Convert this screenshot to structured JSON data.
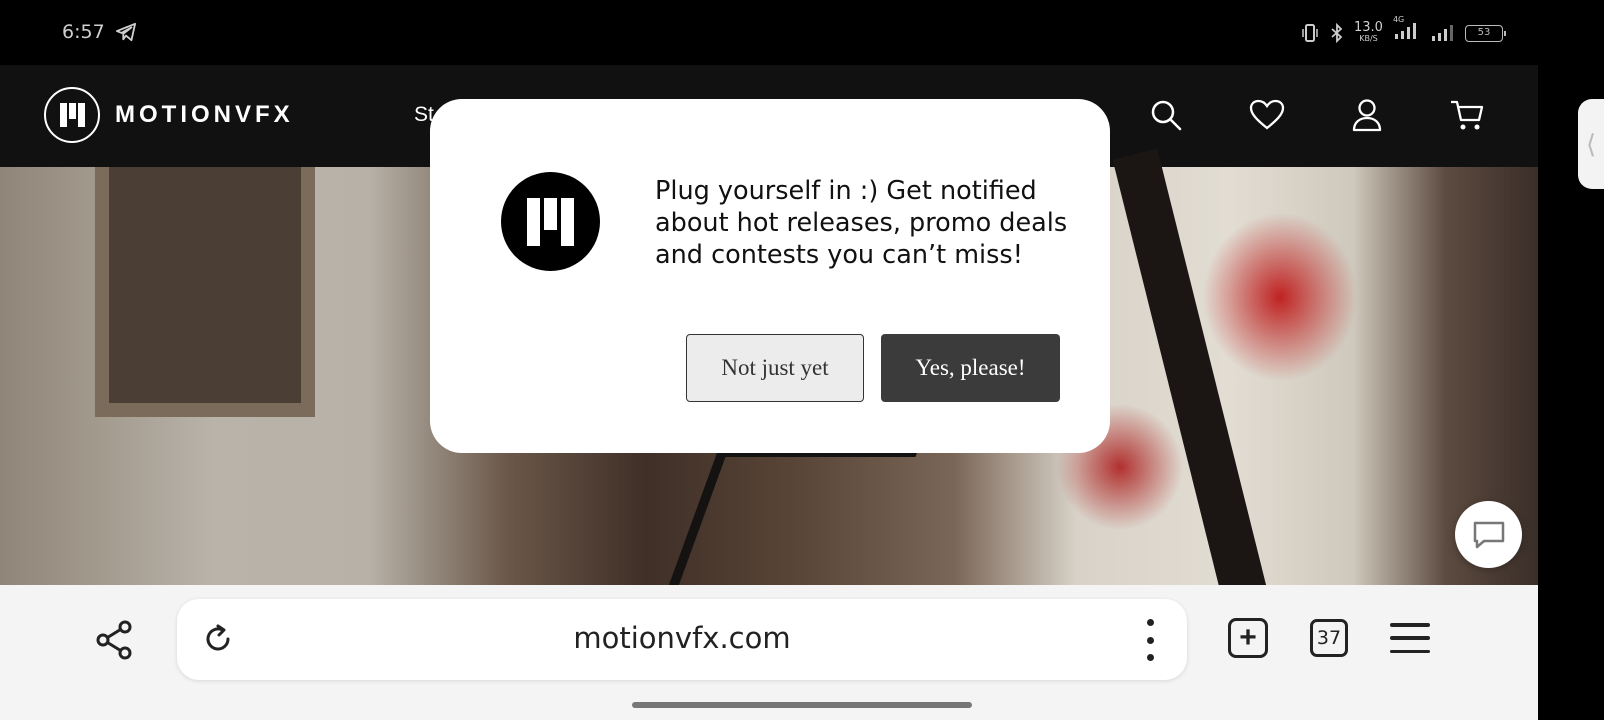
{
  "status_bar": {
    "time": "6:57",
    "network_speed_value": "13.0",
    "network_speed_unit": "KB/S",
    "network_type": "4G",
    "battery_level": "53",
    "icons": [
      "telegram-icon",
      "vibrate-icon",
      "bluetooth-icon",
      "signal-icon",
      "signal-icon",
      "battery-icon"
    ]
  },
  "site": {
    "logo_text": "MOTIONVFX",
    "nav_partial_label": "St",
    "icons": [
      "search-icon",
      "heart-icon",
      "user-icon",
      "cart-icon",
      "chat-icon"
    ]
  },
  "dialog": {
    "message": "Plug yourself in :) Get notified about hot releases, promo deals and contests you can’t miss!",
    "decline_label": "Not just yet",
    "accept_label": "Yes, please!"
  },
  "browser": {
    "url": "motionvfx.com",
    "tab_count": "37",
    "icons": [
      "share-icon",
      "refresh-icon",
      "more-icon",
      "new-tab-icon",
      "tabs-icon",
      "menu-icon"
    ]
  },
  "colors": {
    "nav_background": "#111111",
    "accept_button": "#3b3b3b",
    "decline_button": "#ececec",
    "browser_bar": "#f4f4f4"
  }
}
